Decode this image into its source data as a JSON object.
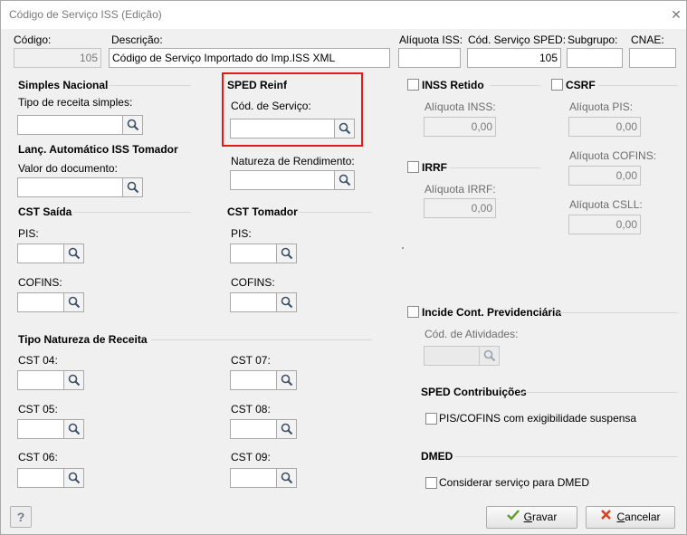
{
  "window": {
    "title": "Código de Serviço ISS (Edição)"
  },
  "top": {
    "codigo_label": "Código:",
    "codigo_value": "105",
    "descricao_label": "Descrição:",
    "descricao_value": "Código de Serviço Importado do Imp.ISS XML",
    "aliquota_iss_label": "Alíquota ISS:",
    "aliquota_iss_value": "",
    "cod_sped_label": "Cód. Serviço SPED:",
    "cod_sped_value": "105",
    "subgrupo_label": "Subgrupo:",
    "subgrupo_value": "",
    "cnae_label": "CNAE:",
    "cnae_value": ""
  },
  "simples": {
    "heading": "Simples Nacional",
    "tipo_label": "Tipo de receita simples:"
  },
  "lanc": {
    "heading": "Lanç. Automático ISS Tomador",
    "valor_label": "Valor do documento:"
  },
  "reinf": {
    "heading": "SPED Reinf",
    "cod_label": "Cód. de Serviço:",
    "natureza_label": "Natureza de Rendimento:"
  },
  "cst_saida": {
    "heading": "CST Saída",
    "pis_label": "PIS:",
    "cofins_label": "COFINS:"
  },
  "cst_tomador": {
    "heading": "CST Tomador",
    "pis_label": "PIS:",
    "cofins_label": "COFINS:"
  },
  "natureza_receita": {
    "heading": "Tipo Natureza de Receita",
    "cst04": "CST 04:",
    "cst05": "CST 05:",
    "cst06": "CST 06:",
    "cst07": "CST 07:",
    "cst08": "CST 08:",
    "cst09": "CST 09:"
  },
  "inss": {
    "label": "INSS Retido",
    "aliquota_label": "Alíquota INSS:",
    "aliquota_value": "0,00"
  },
  "irrf": {
    "label": "IRRF",
    "aliquota_label": "Alíquota IRRF:",
    "aliquota_value": "0,00"
  },
  "csrf": {
    "label": "CSRF",
    "pis_label": "Alíquota PIS:",
    "pis_value": "0,00",
    "cofins_label": "Alíquota COFINS:",
    "cofins_value": "0,00",
    "csll_label": "Alíquota CSLL:",
    "csll_value": "0,00"
  },
  "previdenciaria": {
    "label": "Incide Cont. Previdenciária",
    "atividades_label": "Cód. de Atividades:"
  },
  "sped_contrib": {
    "heading": "SPED Contribuições",
    "check_label": "PIS/COFINS com exigibilidade suspensa"
  },
  "dmed": {
    "heading": "DMED",
    "check_label": "Considerar serviço para DMED"
  },
  "buttons": {
    "help": "?",
    "gravar_pre": "",
    "gravar_u": "G",
    "gravar_rest": "ravar",
    "cancelar_u": "C",
    "cancelar_rest": "ancelar"
  },
  "icons": {
    "search": "magnifier-icon",
    "close": "close-icon",
    "check": "check-icon",
    "cancel": "x-icon"
  }
}
